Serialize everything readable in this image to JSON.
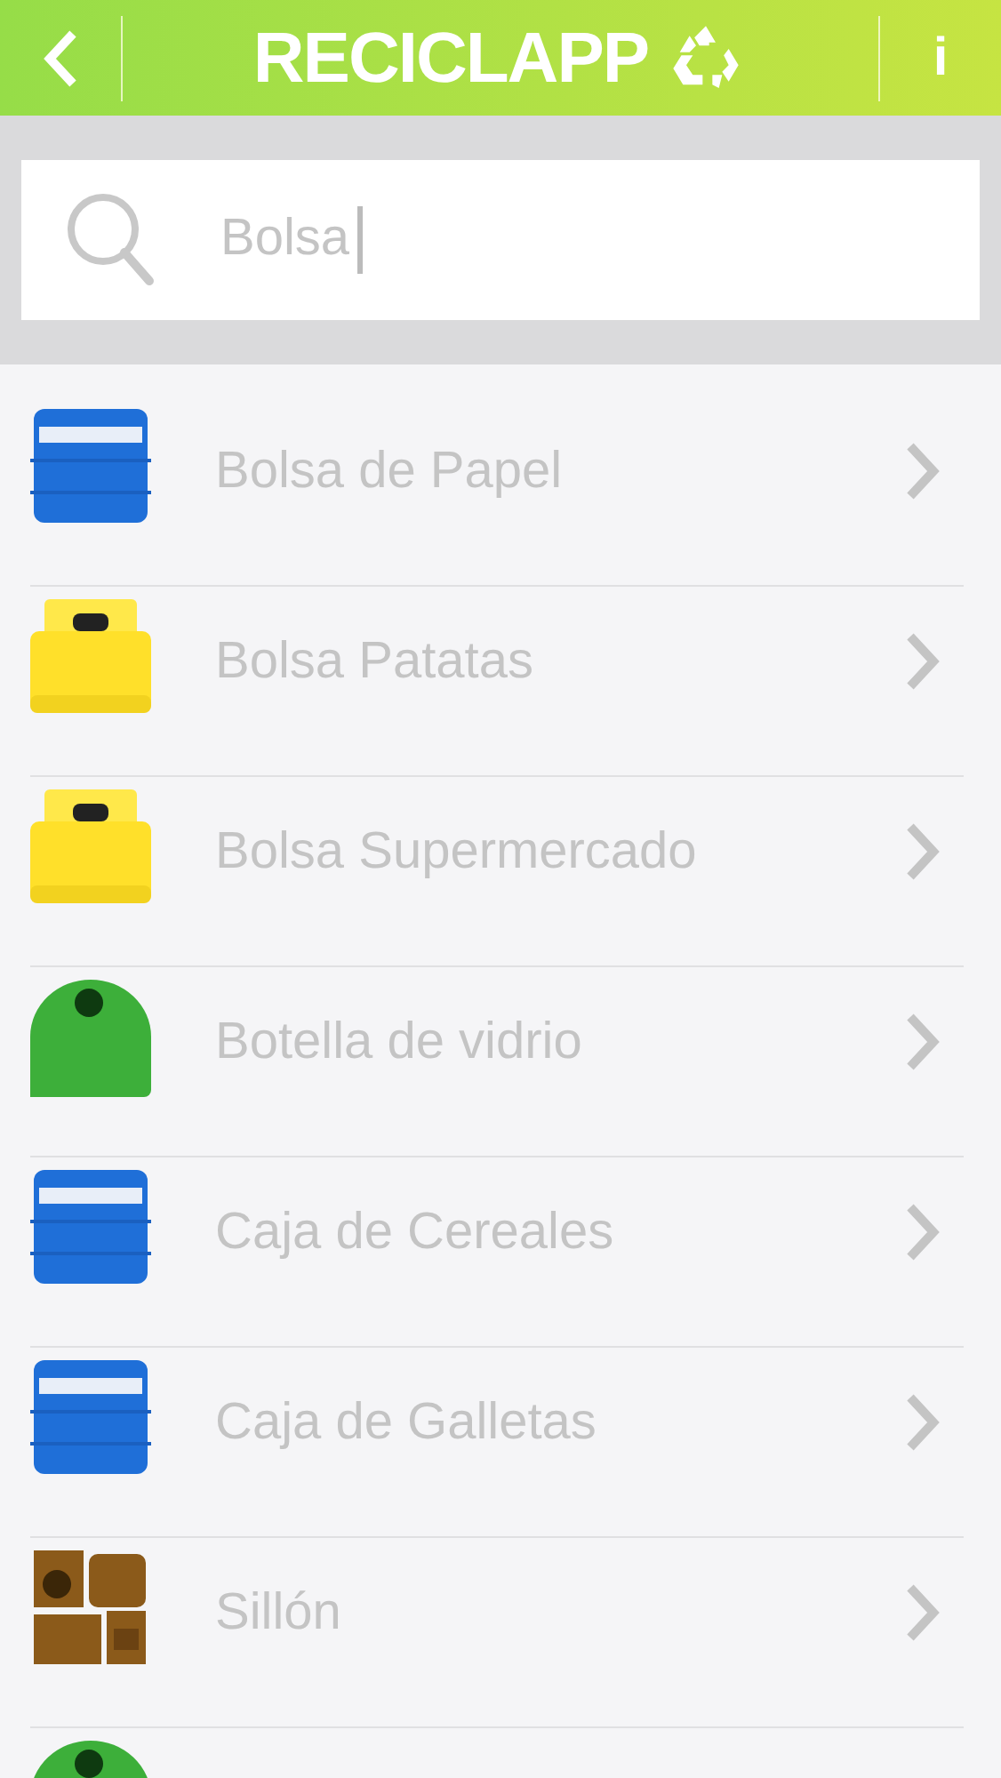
{
  "header": {
    "title": "RECICLAPP",
    "info": "i"
  },
  "search": {
    "value": "Bolsa"
  },
  "items": [
    {
      "label": "Bolsa de Papel",
      "kind": "blue"
    },
    {
      "label": "Bolsa Patatas",
      "kind": "yellow"
    },
    {
      "label": "Bolsa Supermercado",
      "kind": "yellow"
    },
    {
      "label": "Botella de vidrio",
      "kind": "green"
    },
    {
      "label": "Caja de Cereales",
      "kind": "blue"
    },
    {
      "label": "Caja de Galletas",
      "kind": "blue"
    },
    {
      "label": "Sillón",
      "kind": "furniture"
    },
    {
      "kind": "green"
    }
  ]
}
